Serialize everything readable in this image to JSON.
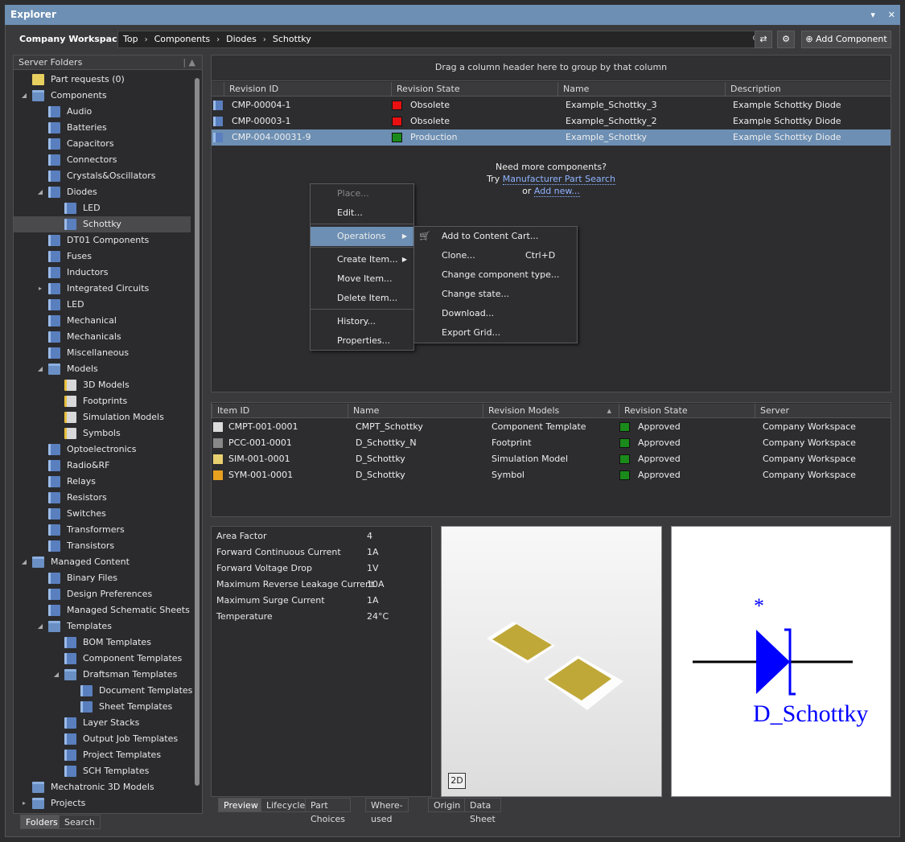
{
  "window": {
    "title": "Explorer",
    "pin": "▾",
    "close": "✕"
  },
  "toolbar": {
    "workspace": "Company Workspace",
    "workspace_arrow": "▾",
    "path": [
      "Top",
      "Components",
      "Diodes",
      "Schottky"
    ],
    "path_sep": "›",
    "search_icon": "⚲",
    "refresh_icon": "⇄",
    "settings_icon": "⚙",
    "add_label": "Add Component",
    "add_icon": "⊕"
  },
  "left_panel": {
    "header": "Server Folders",
    "header_ctrl": "|  ▲",
    "tabs": [
      "Folders",
      "Search"
    ],
    "tree": [
      {
        "label": "Part requests (0)",
        "icon": "part-request-icon"
      },
      {
        "label": "Components",
        "arrow": "◢",
        "icon": "folder-icon"
      },
      {
        "label": "Audio"
      },
      {
        "label": "Batteries"
      },
      {
        "label": "Capacitors"
      },
      {
        "label": "Connectors"
      },
      {
        "label": "Crystals&Oscillators"
      },
      {
        "label": "Diodes",
        "arrow": "◢"
      },
      {
        "label": "LED"
      },
      {
        "label": "Schottky"
      },
      {
        "label": "DT01 Components"
      },
      {
        "label": "Fuses"
      },
      {
        "label": "Inductors"
      },
      {
        "label": "Integrated Circuits",
        "arrow": "▸"
      },
      {
        "label": "LED"
      },
      {
        "label": "Mechanical"
      },
      {
        "label": "Mechanicals"
      },
      {
        "label": "Miscellaneous"
      },
      {
        "label": "Models",
        "arrow": "◢"
      },
      {
        "label": "3D Models"
      },
      {
        "label": "Footprints"
      },
      {
        "label": "Simulation Models"
      },
      {
        "label": "Symbols"
      },
      {
        "label": "Optoelectronics"
      },
      {
        "label": "Radio&RF"
      },
      {
        "label": "Relays"
      },
      {
        "label": "Resistors"
      },
      {
        "label": "Switches"
      },
      {
        "label": "Transformers"
      },
      {
        "label": "Transistors"
      },
      {
        "label": "Managed Content",
        "arrow": "◢"
      },
      {
        "label": "Binary Files"
      },
      {
        "label": "Design Preferences"
      },
      {
        "label": "Managed Schematic Sheets"
      },
      {
        "label": "Templates",
        "arrow": "◢"
      },
      {
        "label": "BOM Templates"
      },
      {
        "label": "Component Templates"
      },
      {
        "label": "Draftsman Templates",
        "arrow": "◢"
      },
      {
        "label": "Document Templates"
      },
      {
        "label": "Sheet Templates"
      },
      {
        "label": "Layer Stacks"
      },
      {
        "label": "Output Job Templates"
      },
      {
        "label": "Project Templates"
      },
      {
        "label": "SCH Templates"
      },
      {
        "label": "Mechatronic 3D Models"
      },
      {
        "label": "Projects",
        "arrow": "▸"
      }
    ]
  },
  "revisions": {
    "group_hint": "Drag a column header here to group by that column",
    "columns": [
      "Revision ID",
      "Revision State",
      "Name",
      "Description"
    ],
    "rows": [
      {
        "id": "CMP-00004-1",
        "state": "Obsolete",
        "state_color": "#e81010",
        "name": "Example_Schottky_3",
        "desc": "Example Schottky Diode"
      },
      {
        "id": "CMP-00003-1",
        "state": "Obsolete",
        "state_color": "#e81010",
        "name": "Example_Schottky_2",
        "desc": "Example Schottky Diode"
      },
      {
        "id": "CMP-004-00031-9",
        "state": "Production",
        "state_color": "#1a8a1a",
        "name": "Example_Schottky",
        "desc": "Example Schottky Diode"
      }
    ],
    "need_more": "Need more components?",
    "try": "Try",
    "mps_link": "Manufacturer Part Search",
    "or": "or",
    "add_new_link": "Add new..."
  },
  "context_menu": {
    "items": [
      "Place...",
      "Edit...",
      "Operations",
      "Create Item...",
      "Move Item...",
      "Delete Item...",
      "History...",
      "Properties..."
    ]
  },
  "submenu": {
    "items": [
      "Add to Content Cart...",
      "Clone...",
      "Change component type...",
      "Change state...",
      "Download...",
      "Export Grid..."
    ],
    "clone_shortcut": "Ctrl+D",
    "cart_icon": "🛒"
  },
  "models": {
    "columns": [
      "Item ID",
      "Name",
      "Revision Models",
      "Revision State",
      "Server"
    ],
    "sort_icon": "▲",
    "rows": [
      {
        "id": "CMPT-001-0001",
        "name": "CMPT_Schottky",
        "model": "Component Template",
        "state": "Approved",
        "server": "Company Workspace",
        "state_color": "#1a8a1a"
      },
      {
        "id": "PCC-001-0001",
        "name": "D_Schottky_N",
        "model": "Footprint",
        "state": "Approved",
        "server": "Company Workspace",
        "state_color": "#1a8a1a"
      },
      {
        "id": "SIM-001-0001",
        "name": "D_Schottky",
        "model": "Simulation Model",
        "state": "Approved",
        "server": "Company Workspace",
        "state_color": "#1a8a1a"
      },
      {
        "id": "SYM-001-0001",
        "name": "D_Schottky",
        "model": "Symbol",
        "state": "Approved",
        "server": "Company Workspace",
        "state_color": "#1a8a1a"
      }
    ]
  },
  "parameters": [
    {
      "name": "Area Factor",
      "value": "4"
    },
    {
      "name": "Forward Continuous Current",
      "value": "1A"
    },
    {
      "name": "Forward Voltage Drop",
      "value": "1V"
    },
    {
      "name": "Maximum Reverse Leakage Current",
      "value": "10A"
    },
    {
      "name": "Maximum Surge Current",
      "value": "1A"
    },
    {
      "name": "Temperature",
      "value": "24°C"
    }
  ],
  "preview": {
    "mode_button": "2D"
  },
  "symbol": {
    "designator": "*",
    "comment": "D_Schottky",
    "color": "#0000ff"
  },
  "bottom_tabs": [
    "Preview",
    "Lifecycle",
    "Part Choices",
    "Where-used",
    "Origin",
    "Data Sheet"
  ]
}
